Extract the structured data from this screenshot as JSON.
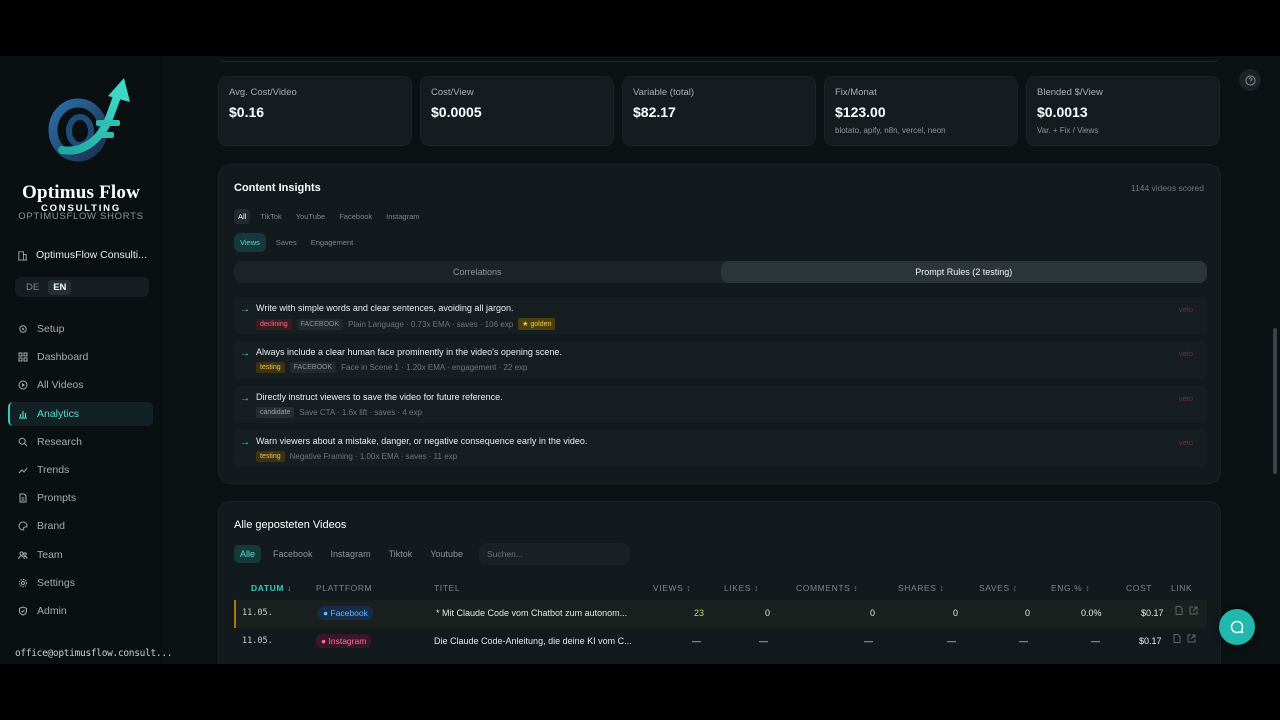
{
  "brand": {
    "name": "Optimus Flow",
    "sub": "CONSULTING",
    "app_label": "OPTIMUSFLOW SHORTS"
  },
  "workspace": {
    "name": "OptimusFlow Consulti..."
  },
  "language": {
    "options": [
      "DE",
      "EN"
    ],
    "active": "EN"
  },
  "nav": [
    {
      "label": "Setup",
      "icon": "settings-gear-icon"
    },
    {
      "label": "Dashboard",
      "icon": "grid-icon"
    },
    {
      "label": "All Videos",
      "icon": "play-circle-icon"
    },
    {
      "label": "Analytics",
      "icon": "bar-chart-icon",
      "active": true
    },
    {
      "label": "Research",
      "icon": "search-icon"
    },
    {
      "label": "Trends",
      "icon": "trend-icon"
    },
    {
      "label": "Prompts",
      "icon": "document-icon"
    },
    {
      "label": "Brand",
      "icon": "palette-icon"
    },
    {
      "label": "Team",
      "icon": "users-icon"
    },
    {
      "label": "Settings",
      "icon": "gear-icon"
    },
    {
      "label": "Admin",
      "icon": "shield-icon"
    }
  ],
  "user": {
    "email": "office@optimusflow.consult..."
  },
  "stats": [
    {
      "label": "Avg. Cost/Video",
      "value": "$0.16",
      "note": ""
    },
    {
      "label": "Cost/View",
      "value": "$0.0005",
      "note": ""
    },
    {
      "label": "Variable (total)",
      "value": "$82.17",
      "note": ""
    },
    {
      "label": "Fix/Monat",
      "value": "$123.00",
      "note": "blotato, apify, n8n, vercel, neon"
    },
    {
      "label": "Blended $/View",
      "value": "$0.0013",
      "note": "Var. + Fix / Views"
    }
  ],
  "insights": {
    "title": "Content Insights",
    "scored": "1144 videos scored",
    "platforms": [
      "All",
      "TikTok",
      "YouTube",
      "Facebook",
      "Instagram"
    ],
    "active_platform": "All",
    "metrics": [
      "Views",
      "Saves",
      "Engagement"
    ],
    "active_metric": "Views",
    "tabs": [
      "Correlations",
      "Prompt Rules (2 testing)"
    ],
    "active_tab": "Prompt Rules (2 testing)",
    "veto_label": "veto",
    "rules": [
      {
        "text": "Write with simple words and clear sentences, avoiding all jargon.",
        "status": "declining",
        "platform": "FACEBOOK",
        "detail": "Plain Language · 0.73x EMA · saves · 106 exp",
        "golden": "★ golden"
      },
      {
        "text": "Always include a clear human face prominently in the video's opening scene.",
        "status": "testing",
        "platform": "FACEBOOK",
        "detail": "Face in Scene 1 · 1.20x EMA · engagement · 22 exp",
        "golden": ""
      },
      {
        "text": "Directly instruct viewers to save the video for future reference.",
        "status": "candidate",
        "platform": "",
        "detail": "Save CTA · 1.6x lift · saves · 4 exp",
        "golden": ""
      },
      {
        "text": "Warn viewers about a mistake, danger, or negative consequence early in the video.",
        "status": "testing",
        "platform": "",
        "detail": "Negative Framing · 1.00x EMA · saves · 11 exp",
        "golden": ""
      }
    ]
  },
  "videos": {
    "title": "Alle geposteten Videos",
    "filters": [
      "Alle",
      "Facebook",
      "Instagram",
      "Tiktok",
      "Youtube"
    ],
    "active_filter": "Alle",
    "search_placeholder": "Suchen...",
    "columns": [
      "DATUM ↓",
      "PLATTFORM",
      "TITEL",
      "VIEWS ↕",
      "LIKES ↕",
      "COMMENTS ↕",
      "SHARES ↕",
      "SAVES ↕",
      "ENG.% ↕",
      "COST",
      "LINK"
    ],
    "rows": [
      {
        "date": "11.05.",
        "platform": "Facebook",
        "title": "* Mit Claude Code vom Chatbot zum autonom...",
        "views": "23",
        "likes": "0",
        "comments": "0",
        "shares": "0",
        "saves": "0",
        "eng": "0.0%",
        "cost": "$0.17"
      },
      {
        "date": "11.05.",
        "platform": "Instagram",
        "title": "Die Claude Code-Anleitung, die deine KI vom C...",
        "views": "—",
        "likes": "—",
        "comments": "—",
        "shares": "—",
        "saves": "—",
        "eng": "—",
        "cost": "$0.17"
      }
    ]
  },
  "colors": {
    "accent": "#3fc7bd",
    "background": "#0c1214",
    "card": "#151c1f"
  }
}
